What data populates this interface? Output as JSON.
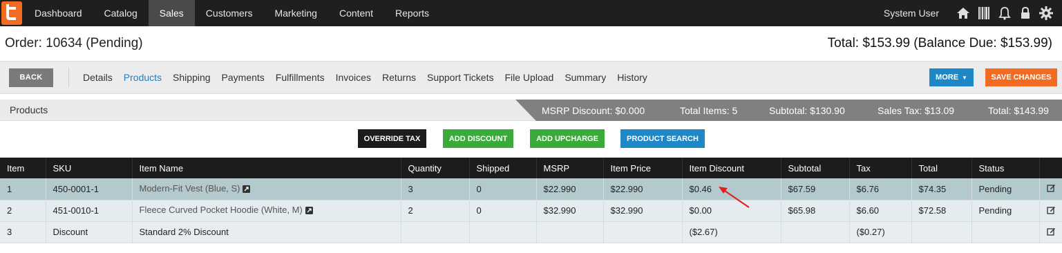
{
  "nav": {
    "items": [
      "Dashboard",
      "Catalog",
      "Sales",
      "Customers",
      "Marketing",
      "Content",
      "Reports"
    ],
    "active_index": 2,
    "user": "System User",
    "icons": [
      "home-icon",
      "barcode-icon",
      "bell-icon",
      "lock-icon",
      "gear-icon"
    ],
    "brand_color": "#f26b22"
  },
  "order": {
    "title": "Order: 10634 (Pending)",
    "total": "Total: $153.99 (Balance Due: $153.99)"
  },
  "toolbar": {
    "back_label": "BACK",
    "tabs": [
      "Details",
      "Products",
      "Shipping",
      "Payments",
      "Fulfillments",
      "Invoices",
      "Returns",
      "Support Tickets",
      "File Upload",
      "Summary",
      "History"
    ],
    "active_tab": "Products",
    "more_label": "MORE",
    "save_label": "SAVE CHANGES",
    "accent": "#1e88c7",
    "save_color": "#f26b22"
  },
  "products_band": {
    "label": "Products",
    "msrp_discount": "MSRP Discount: $0.000",
    "total_items": "Total Items: 5",
    "subtotal": "Subtotal: $130.90",
    "sales_tax": "Sales Tax: $13.09",
    "total": "Total: $143.99"
  },
  "actions": {
    "override_tax": "OVERRIDE TAX",
    "add_discount": "ADD DISCOUNT",
    "add_upcharge": "ADD UPCHARGE",
    "product_search": "PRODUCT SEARCH"
  },
  "table": {
    "headers": [
      "Item",
      "SKU",
      "Item Name",
      "Quantity",
      "Shipped",
      "MSRP",
      "Item Price",
      "Item Discount",
      "Subtotal",
      "Tax",
      "Total",
      "Status",
      ""
    ],
    "rows": [
      [
        "1",
        "450-0001-1",
        "Modern-Fit Vest (Blue, S)",
        "3",
        "0",
        "$22.990",
        "$22.990",
        "$0.46",
        "$67.59",
        "$6.76",
        "$74.35",
        "Pending"
      ],
      [
        "2",
        "451-0010-1",
        "Fleece Curved Pocket Hoodie (White, M)",
        "2",
        "0",
        "$32.990",
        "$32.990",
        "$0.00",
        "$65.98",
        "$6.60",
        "$72.58",
        "Pending"
      ],
      [
        "3",
        "Discount",
        "Standard 2% Discount",
        "",
        "",
        "",
        "",
        "($2.67)",
        "",
        "($0.27)",
        "",
        ""
      ]
    ]
  }
}
